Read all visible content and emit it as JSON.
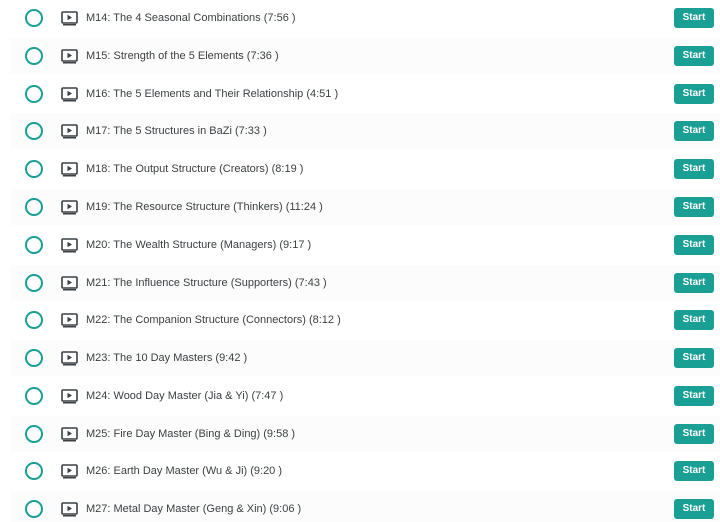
{
  "lessons": [
    {
      "title": "M14: The 4 Seasonal Combinations (7:56 )",
      "action": "Start"
    },
    {
      "title": "M15: Strength of the 5 Elements (7:36 )",
      "action": "Start"
    },
    {
      "title": "M16: The 5 Elements and Their Relationship (4:51 )",
      "action": "Start"
    },
    {
      "title": "M17: The 5 Structures in BaZi (7:33 )",
      "action": "Start"
    },
    {
      "title": "M18: The Output Structure (Creators) (8:19 )",
      "action": "Start"
    },
    {
      "title": "M19: The Resource Structure (Thinkers) (11:24 )",
      "action": "Start"
    },
    {
      "title": "M20: The Wealth Structure (Managers) (9:17 )",
      "action": "Start"
    },
    {
      "title": "M21: The Influence Structure (Supporters) (7:43 )",
      "action": "Start"
    },
    {
      "title": "M22: The Companion Structure (Connectors) (8:12 )",
      "action": "Start"
    },
    {
      "title": "M23: The 10 Day Masters (9:42 )",
      "action": "Start"
    },
    {
      "title": "M24: Wood Day Master (Jia & Yi) (7:47 )",
      "action": "Start"
    },
    {
      "title": "M25: Fire Day Master (Bing & Ding) (9:58 )",
      "action": "Start"
    },
    {
      "title": "M26: Earth Day Master (Wu & Ji) (9:20 )",
      "action": "Start"
    },
    {
      "title": "M27: Metal Day Master (Geng & Xin) (9:06 )",
      "action": "Start"
    }
  ],
  "icons": {
    "status": "incomplete-circle-icon",
    "lesson_type": "video-icon"
  },
  "colors": {
    "accent": "#1a9f95",
    "text": "#3c4043",
    "icon": "#3c4043"
  }
}
